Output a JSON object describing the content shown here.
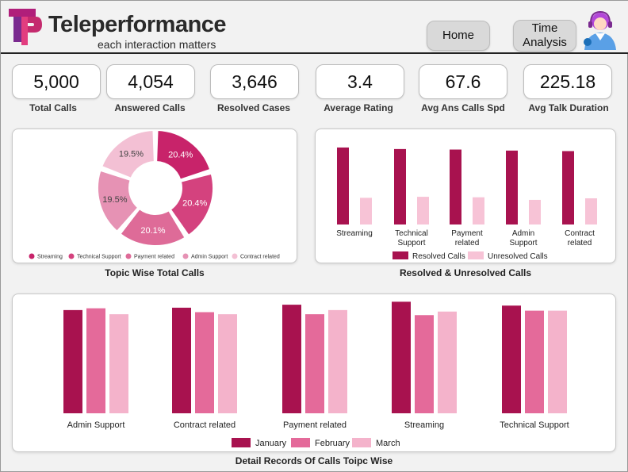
{
  "brand": {
    "name": "Teleperformance",
    "tagline": "each interaction matters"
  },
  "nav": {
    "home": "Home",
    "time_line1": "Time",
    "time_line2": "Analysis"
  },
  "kpis": [
    {
      "value": "5,000",
      "label": "Total Calls"
    },
    {
      "value": "4,054",
      "label": "Answered Calls"
    },
    {
      "value": "3,646",
      "label": "Resolved Cases"
    },
    {
      "value": "3.4",
      "label": "Average Rating"
    },
    {
      "value": "67.6",
      "label": "Avg Ans Calls Spd"
    },
    {
      "value": "225.18",
      "label": "Avg Talk Duration"
    }
  ],
  "colors": {
    "dark": "#a8124f",
    "mid": "#d64283",
    "medium": "#e46a9a",
    "light": "#f4b3cb",
    "lighter": "#f7c3d6",
    "pie": [
      "#c8236a",
      "#d4427e",
      "#de6b98",
      "#e692b4",
      "#f3c0d4"
    ]
  },
  "chart_data": [
    {
      "type": "pie",
      "title": "Topic Wise Total Calls",
      "labels": [
        "Streaming",
        "Technical Support",
        "Payment related",
        "Admin Support",
        "Contract related"
      ],
      "values": [
        20.4,
        20.4,
        20.1,
        19.5,
        19.5
      ],
      "value_labels": [
        "20.4%",
        "20.4%",
        "20.1%",
        "19.5%",
        "19.5%"
      ],
      "legend": "bottom"
    },
    {
      "type": "bar",
      "title": "Resolved & Unresolved Calls",
      "categories": [
        [
          "Streaming"
        ],
        [
          "Technical",
          "Support"
        ],
        [
          "Payment",
          "related"
        ],
        [
          "Admin",
          "Support"
        ],
        [
          "Contract",
          "related"
        ]
      ],
      "series": [
        {
          "name": "Resolved Calls",
          "values": [
            750,
            735,
            730,
            720,
            715
          ]
        },
        {
          "name": "Unresolved Calls",
          "values": [
            260,
            270,
            265,
            240,
            255
          ]
        }
      ],
      "ylim": [
        0,
        850
      ],
      "legend": "bottom"
    },
    {
      "type": "bar",
      "title": "Detail Records Of Calls Toipc Wise",
      "categories": [
        "Admin Support",
        "Contract related",
        "Payment related",
        "Streaming",
        "Technical Support"
      ],
      "series": [
        {
          "name": "January",
          "values": [
            347,
            355,
            365,
            375,
            362
          ]
        },
        {
          "name": "February",
          "values": [
            353,
            340,
            333,
            330,
            345
          ]
        },
        {
          "name": "March",
          "values": [
            333,
            333,
            347,
            342,
            345
          ]
        }
      ],
      "ylim": [
        0,
        400
      ],
      "legend": "bottom"
    }
  ]
}
